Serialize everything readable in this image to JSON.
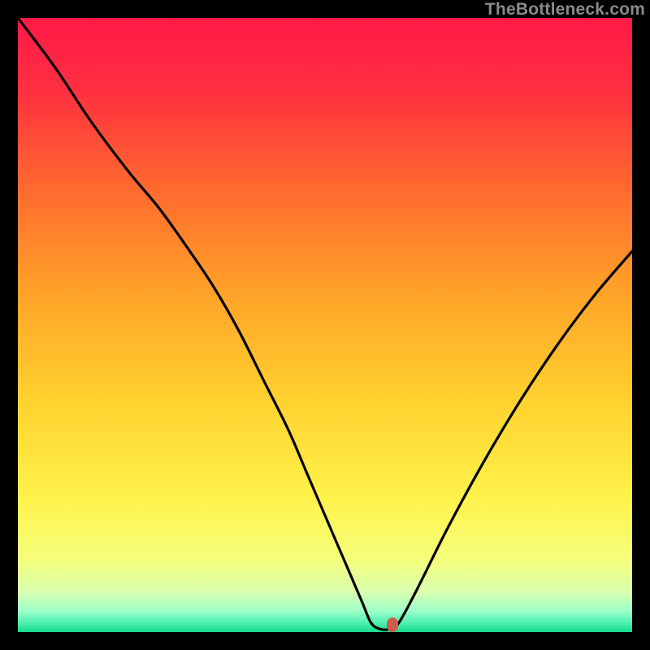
{
  "watermark": "TheBottleneck.com",
  "colors": {
    "frame": "#000000",
    "curve": "#000000",
    "marker": "#cf5b4a",
    "gradient_stops": [
      {
        "offset": 0.0,
        "color": "#ff1947"
      },
      {
        "offset": 0.12,
        "color": "#ff3040"
      },
      {
        "offset": 0.28,
        "color": "#ff6a2e"
      },
      {
        "offset": 0.45,
        "color": "#ffa328"
      },
      {
        "offset": 0.62,
        "color": "#ffd12e"
      },
      {
        "offset": 0.78,
        "color": "#fff24a"
      },
      {
        "offset": 0.88,
        "color": "#f6ff7a"
      },
      {
        "offset": 0.935,
        "color": "#d8ffb0"
      },
      {
        "offset": 0.965,
        "color": "#9effc8"
      },
      {
        "offset": 0.985,
        "color": "#4cf0b0"
      },
      {
        "offset": 1.0,
        "color": "#16d98a"
      }
    ]
  },
  "chart_data": {
    "type": "line",
    "title": "",
    "xlabel": "",
    "ylabel": "",
    "xlim": [
      0,
      100
    ],
    "ylim": [
      0,
      100
    ],
    "x": [
      0,
      6,
      12,
      18,
      23,
      28,
      32,
      36,
      40,
      44,
      47,
      50,
      53,
      56,
      57.5,
      59,
      60.5,
      62,
      65,
      70,
      76,
      82,
      88,
      94,
      100
    ],
    "values": [
      100,
      92,
      83,
      75,
      69,
      62,
      56,
      49,
      41,
      33,
      26,
      19,
      12,
      5,
      1.5,
      0.5,
      0.5,
      1.5,
      7,
      17,
      28,
      38,
      47,
      55,
      62
    ],
    "marker": {
      "x": 61,
      "y": 1.2
    },
    "annotations": []
  }
}
